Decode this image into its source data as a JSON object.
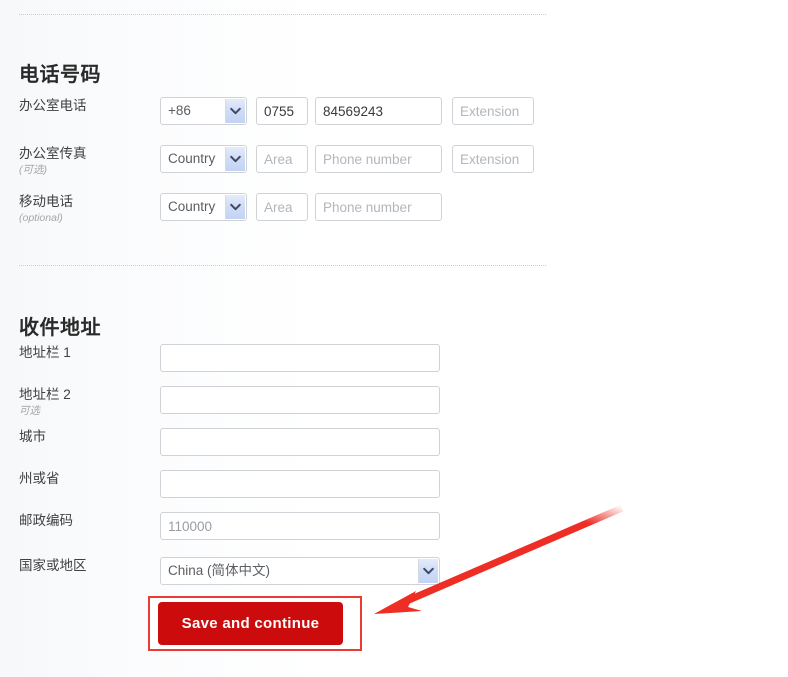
{
  "accent_colors": {
    "button_red": "#cc0c0c",
    "highlight_border_red": "#ea3b35",
    "arrow_red": "#ee2d24",
    "field_border": "#cfd2d6",
    "select_arrow_button": "#cfdcf6"
  },
  "phone_section": {
    "title": "电话号码",
    "rows": [
      {
        "label": "办公室电话",
        "optional_note": "",
        "country_value": "+86",
        "area_value": "0755",
        "area_placeholder": "Area",
        "number_value": "84569243",
        "number_placeholder": "Phone number",
        "extension_value": "",
        "extension_placeholder": "Extension",
        "has_extension": true
      },
      {
        "label": "办公室传真",
        "optional_note": "(可选)",
        "country_value": "Country",
        "area_value": "",
        "area_placeholder": "Area",
        "number_value": "",
        "number_placeholder": "Phone number",
        "extension_value": "",
        "extension_placeholder": "Extension",
        "has_extension": true
      },
      {
        "label": "移动电话",
        "optional_note": "(optional)",
        "country_value": "Country",
        "area_value": "",
        "area_placeholder": "Area",
        "number_value": "",
        "number_placeholder": "Phone number",
        "extension_value": "",
        "extension_placeholder": "",
        "has_extension": false
      }
    ]
  },
  "address_section": {
    "title": "收件地址",
    "rows": [
      {
        "label": "地址栏 1",
        "optional_note": "",
        "value": "",
        "placeholder": ""
      },
      {
        "label": "地址栏 2",
        "optional_note": "可选",
        "value": "",
        "placeholder": ""
      },
      {
        "label": "城市",
        "optional_note": "",
        "value": "",
        "placeholder": ""
      },
      {
        "label": "州或省",
        "optional_note": "",
        "value": "",
        "placeholder": ""
      },
      {
        "label": "邮政编码",
        "optional_note": "",
        "value": "110000",
        "placeholder": "110000"
      }
    ],
    "country_row": {
      "label": "国家或地区",
      "selected": "China (简体中文)"
    }
  },
  "actions": {
    "save_label": "Save and continue"
  }
}
